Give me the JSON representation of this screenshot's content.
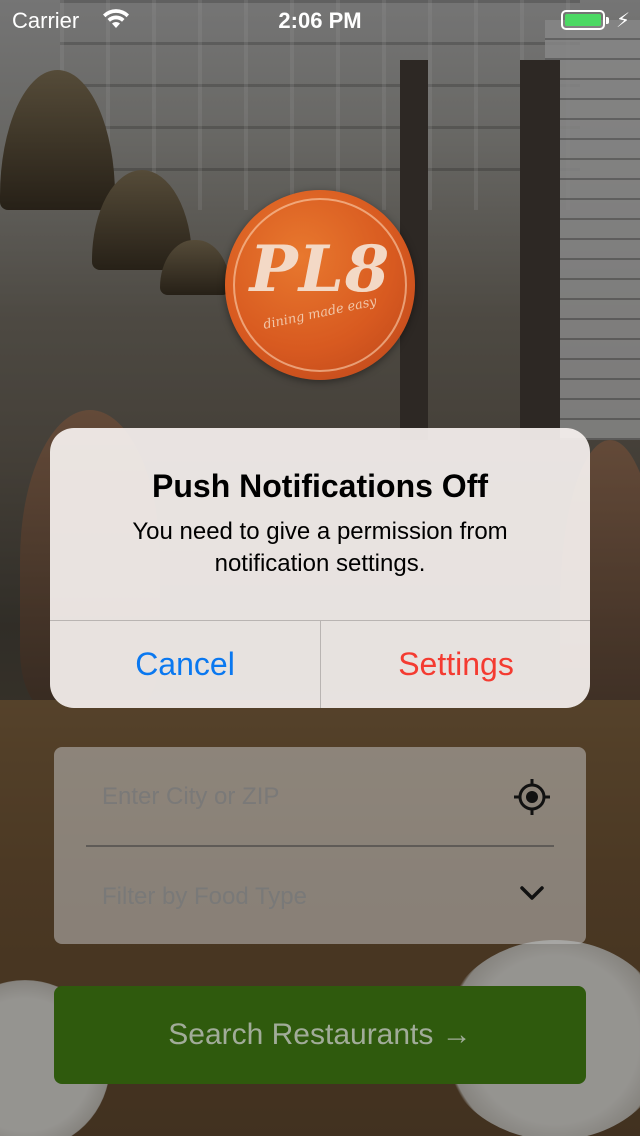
{
  "status_bar": {
    "carrier": "Carrier",
    "time": "2:06 PM",
    "wifi_icon": "wifi-icon",
    "battery_icon": "battery-icon",
    "battery_color": "#4cd964",
    "charging_icon": "bolt-icon"
  },
  "logo": {
    "wordmark": "PL8",
    "tagline": "dining made easy",
    "color": "#d85a20"
  },
  "alert": {
    "title": "Push Notifications Off",
    "message": "You need to give a permission from notification settings.",
    "cancel_label": "Cancel",
    "settings_label": "Settings",
    "cancel_color": "#0a78f0",
    "settings_color": "#f43b31"
  },
  "form": {
    "location_placeholder": "Enter City or ZIP",
    "location_icon": "crosshair-icon",
    "food_filter_placeholder": "Filter by Food Type",
    "food_filter_icon": "chevron-down-icon"
  },
  "search_button": {
    "label": "Search Restaurants →",
    "color": "#2f5a0d"
  }
}
